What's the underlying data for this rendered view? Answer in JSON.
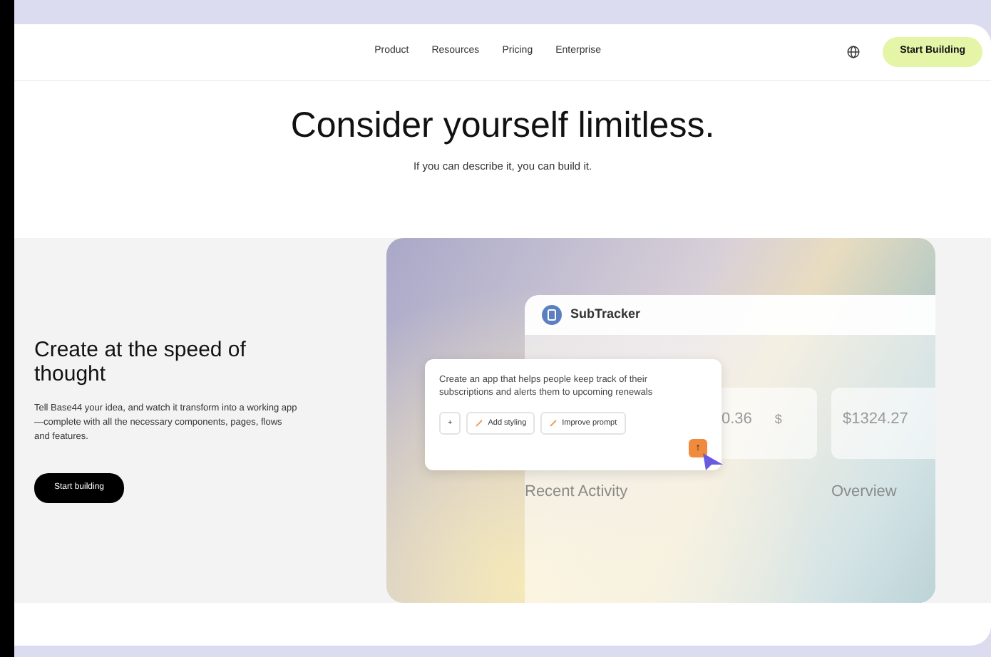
{
  "nav": {
    "links": [
      {
        "label": "Product"
      },
      {
        "label": "Resources"
      },
      {
        "label": "Pricing"
      },
      {
        "label": "Enterprise"
      }
    ],
    "cta": "Start Building"
  },
  "hero": {
    "title": "Consider yourself limitless.",
    "subtitle": "If you can describe it, you can build it."
  },
  "feature": {
    "title": "Create at the speed of thought",
    "body": "Tell Base44 your idea, and watch it transform into a working app—complete with all the necessary components, pages, flows and features.",
    "button": "Start building"
  },
  "preview": {
    "app_name": "SubTracker",
    "stats": [
      {
        "value": "0.36",
        "icon": "$"
      },
      {
        "value": "$1324.27"
      }
    ],
    "sections": [
      "Recent Activity",
      "Overview"
    ],
    "prompt": {
      "text": "Create an app that helps people keep track of their subscriptions and alerts them to upcoming renewals",
      "plus": "+",
      "actions": [
        "Add styling",
        "Improve prompt"
      ],
      "send": "↑"
    }
  }
}
